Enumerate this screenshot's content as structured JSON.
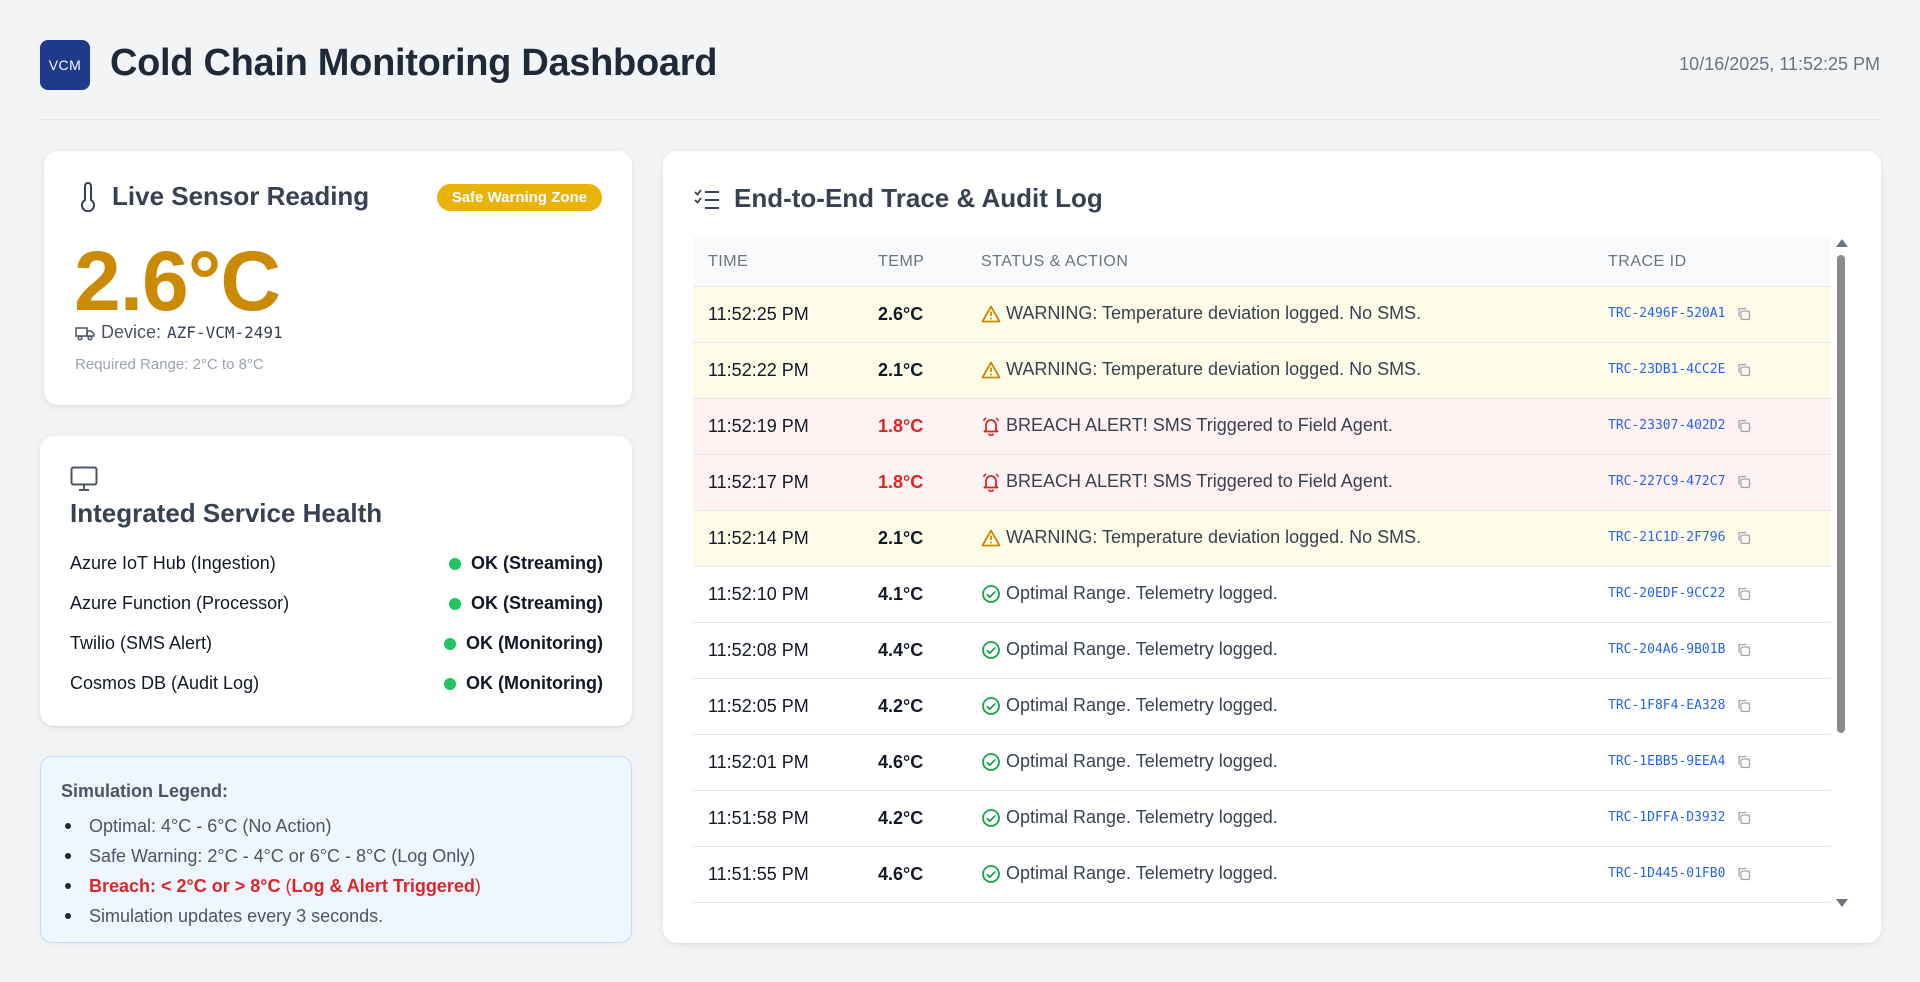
{
  "header": {
    "logo_text": "VCM",
    "title": "Cold Chain Monitoring Dashboard",
    "datetime": "10/16/2025, 11:52:25 PM"
  },
  "sensor": {
    "icon": "thermometer-icon",
    "title": "Live Sensor Reading",
    "zone_badge": "Safe Warning Zone",
    "temperature": "2.6°C",
    "device_label": "Device:",
    "device_id": "AZF-VCM-2491",
    "required_range": "Required Range: 2°C to 8°C",
    "colors": {
      "badge": "#eab308",
      "temperature": "#ca8a04"
    }
  },
  "health": {
    "icon": "monitor-icon",
    "title": "Integrated Service Health",
    "services": [
      {
        "name": "Azure IoT Hub (Ingestion)",
        "status": "OK (Streaming)"
      },
      {
        "name": "Azure Function (Processor)",
        "status": "OK (Streaming)"
      },
      {
        "name": "Twilio (SMS Alert)",
        "status": "OK (Monitoring)"
      },
      {
        "name": "Cosmos DB (Audit Log)",
        "status": "OK (Monitoring)"
      }
    ],
    "status_color": "#22c55e"
  },
  "legend": {
    "title": "Simulation Legend:",
    "items": {
      "optimal": "Optimal: 4°C - 6°C (No Action)",
      "warning": "Safe Warning: 2°C - 4°C or 6°C - 8°C (Log Only)",
      "breach_bold": "Breach: < 2°C or > 8°C",
      "breach_open": " (",
      "breach_action": "Log & Alert Triggered",
      "breach_close": ")",
      "updates": "Simulation updates every 3 seconds."
    }
  },
  "trace": {
    "icon": "list-check-icon",
    "title": "End-to-End Trace & Audit Log",
    "columns": [
      "TIME",
      "TEMP",
      "STATUS & ACTION",
      "TRACE ID"
    ],
    "rows": [
      {
        "type": "warn",
        "time": "11:52:25 PM",
        "temp": "2.6°C",
        "status": "WARNING: Temperature deviation logged. No SMS.",
        "trace_id": "TRC-2496F-520A1"
      },
      {
        "type": "warn",
        "time": "11:52:22 PM",
        "temp": "2.1°C",
        "status": "WARNING: Temperature deviation logged. No SMS.",
        "trace_id": "TRC-23DB1-4CC2E"
      },
      {
        "type": "breach",
        "time": "11:52:19 PM",
        "temp": "1.8°C",
        "status": "BREACH ALERT! SMS Triggered to Field Agent.",
        "trace_id": "TRC-23307-402D2"
      },
      {
        "type": "breach",
        "time": "11:52:17 PM",
        "temp": "1.8°C",
        "status": "BREACH ALERT! SMS Triggered to Field Agent.",
        "trace_id": "TRC-227C9-472C7"
      },
      {
        "type": "warn",
        "time": "11:52:14 PM",
        "temp": "2.1°C",
        "status": "WARNING: Temperature deviation logged. No SMS.",
        "trace_id": "TRC-21C1D-2F796"
      },
      {
        "type": "ok",
        "time": "11:52:10 PM",
        "temp": "4.1°C",
        "status": "Optimal Range. Telemetry logged.",
        "trace_id": "TRC-20EDF-9CC22"
      },
      {
        "type": "ok",
        "time": "11:52:08 PM",
        "temp": "4.4°C",
        "status": "Optimal Range. Telemetry logged.",
        "trace_id": "TRC-204A6-9B01B"
      },
      {
        "type": "ok",
        "time": "11:52:05 PM",
        "temp": "4.2°C",
        "status": "Optimal Range. Telemetry logged.",
        "trace_id": "TRC-1F8F4-EA328"
      },
      {
        "type": "ok",
        "time": "11:52:01 PM",
        "temp": "4.6°C",
        "status": "Optimal Range. Telemetry logged.",
        "trace_id": "TRC-1EBB5-9EEA4"
      },
      {
        "type": "ok",
        "time": "11:51:58 PM",
        "temp": "4.2°C",
        "status": "Optimal Range. Telemetry logged.",
        "trace_id": "TRC-1DFFA-D3932"
      },
      {
        "type": "ok",
        "time": "11:51:55 PM",
        "temp": "4.6°C",
        "status": "Optimal Range. Telemetry logged.",
        "trace_id": "TRC-1D445-01FB0"
      }
    ],
    "colors": {
      "warn": "#ca8a04",
      "breach": "#dc2626",
      "ok": "#16a34a",
      "trace_id": "#2563eb"
    }
  }
}
